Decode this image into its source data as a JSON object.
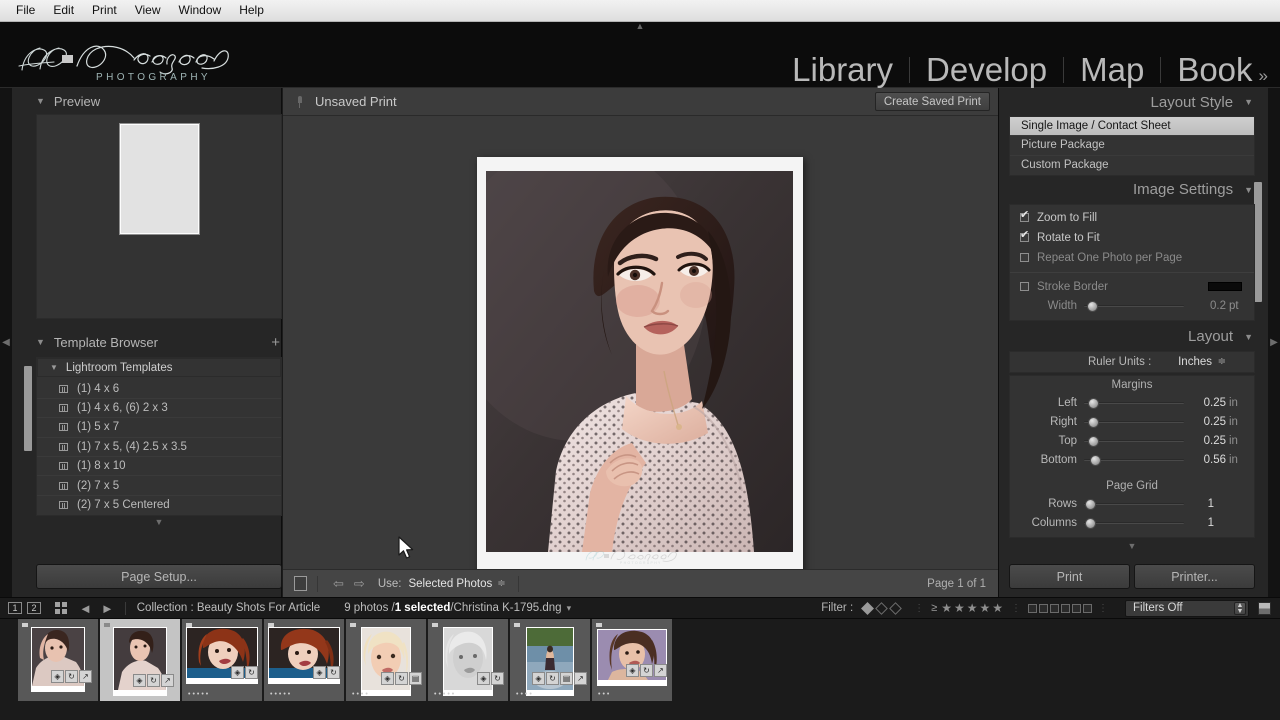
{
  "menubar": {
    "items": [
      "File",
      "Edit",
      "Print",
      "View",
      "Window",
      "Help"
    ]
  },
  "branding": {
    "name": "Designs",
    "tagline": "PHOTOGRAPHY"
  },
  "modules": {
    "items": [
      "Library",
      "Develop",
      "Map",
      "Book"
    ],
    "overflow": "»"
  },
  "left_panel": {
    "preview": {
      "title": "Preview",
      "twirl": "▼"
    },
    "template_browser": {
      "title": "Template Browser",
      "twirl": "▼",
      "add": "+",
      "group": {
        "label": "Lightroom Templates",
        "twirl": "▼"
      },
      "templates": [
        "(1) 4 x 6",
        "(1) 4 x 6, (6) 2 x 3",
        "(1) 5 x 7",
        "(1) 7 x 5, (4) 2.5 x 3.5",
        "(1) 8 x 10",
        "(2) 7 x 5",
        "(2) 7 x 5 Centered"
      ]
    },
    "page_setup_button": "Page Setup..."
  },
  "center": {
    "title": "Unsaved Print",
    "create_saved_print": "Create Saved Print",
    "toolbar": {
      "use_label": "Use:",
      "use_value": "Selected Photos",
      "use_caret": "≑",
      "prev_arrow": "⇦",
      "next_arrow": "⇨",
      "page_of": "Page 1 of 1"
    },
    "identity_plate": "Designs"
  },
  "right_panel": {
    "layout_style": {
      "title": "Layout Style",
      "twirl": "▼",
      "options": [
        "Single Image / Contact Sheet",
        "Picture Package",
        "Custom Package"
      ],
      "selected": "Single Image / Contact Sheet"
    },
    "image_settings": {
      "title": "Image Settings",
      "twirl": "▼",
      "checkboxes": [
        {
          "label": "Zoom to Fill",
          "checked": true,
          "enabled": true
        },
        {
          "label": "Rotate to Fit",
          "checked": true,
          "enabled": true
        },
        {
          "label": "Repeat One Photo per Page",
          "checked": false,
          "enabled": false
        }
      ],
      "stroke_border": {
        "label": "Stroke Border",
        "checked": false,
        "color": "#0a0a0a"
      },
      "width": {
        "label": "Width",
        "value": "0.2",
        "unit": "pt",
        "pos": 4
      }
    },
    "layout": {
      "title": "Layout",
      "twirl": "▼",
      "ruler_units": {
        "label": "Ruler Units :",
        "value": "Inches"
      },
      "margins_title": "Margins",
      "margins": [
        {
          "label": "Left",
          "value": "0.25",
          "unit": "in",
          "pos": 5
        },
        {
          "label": "Right",
          "value": "0.25",
          "unit": "in",
          "pos": 5
        },
        {
          "label": "Top",
          "value": "0.25",
          "unit": "in",
          "pos": 5
        },
        {
          "label": "Bottom",
          "value": "0.56",
          "unit": "in",
          "pos": 6
        }
      ],
      "page_grid_title": "Page Grid",
      "page_grid": [
        {
          "label": "Rows",
          "value": "1",
          "unit": "",
          "pos": 2
        },
        {
          "label": "Columns",
          "value": "1",
          "unit": "",
          "pos": 2
        }
      ]
    },
    "print_button": "Print",
    "printer_button": "Printer..."
  },
  "filmstrip_header": {
    "screen1": "1",
    "screen2": "2",
    "collection": "Collection : Beauty Shots For Article",
    "photo_count": "9 photos /",
    "selected": "1 selected",
    "filename": "/Christina K-1795.dng",
    "caret": "▾",
    "filter_label": "Filter :",
    "ge": "≥",
    "stars": "★★★★★",
    "filters_off": "Filters Off"
  },
  "filmstrip": {
    "thumbnails": [
      {
        "rating": "",
        "selected": false,
        "badges": [
          "◈",
          "↻",
          "↗"
        ]
      },
      {
        "rating": "",
        "selected": true,
        "badges": [
          "◈",
          "↻",
          "↗"
        ]
      },
      {
        "rating": "•••••",
        "selected": false,
        "badges": [
          "◈",
          "↻"
        ]
      },
      {
        "rating": "•••••",
        "selected": false,
        "badges": [
          "◈",
          "↻"
        ]
      },
      {
        "rating": "••••",
        "selected": false,
        "badges": [
          "◈",
          "↻",
          "▤"
        ]
      },
      {
        "rating": "•••••",
        "selected": false,
        "badges": [
          "◈",
          "↻"
        ]
      },
      {
        "rating": "••••",
        "selected": false,
        "badges": [
          "◈",
          "↻",
          "▤",
          "↗"
        ]
      },
      {
        "rating": "•••",
        "selected": false,
        "badges": [
          "◈",
          "↻",
          "↗"
        ]
      }
    ]
  }
}
